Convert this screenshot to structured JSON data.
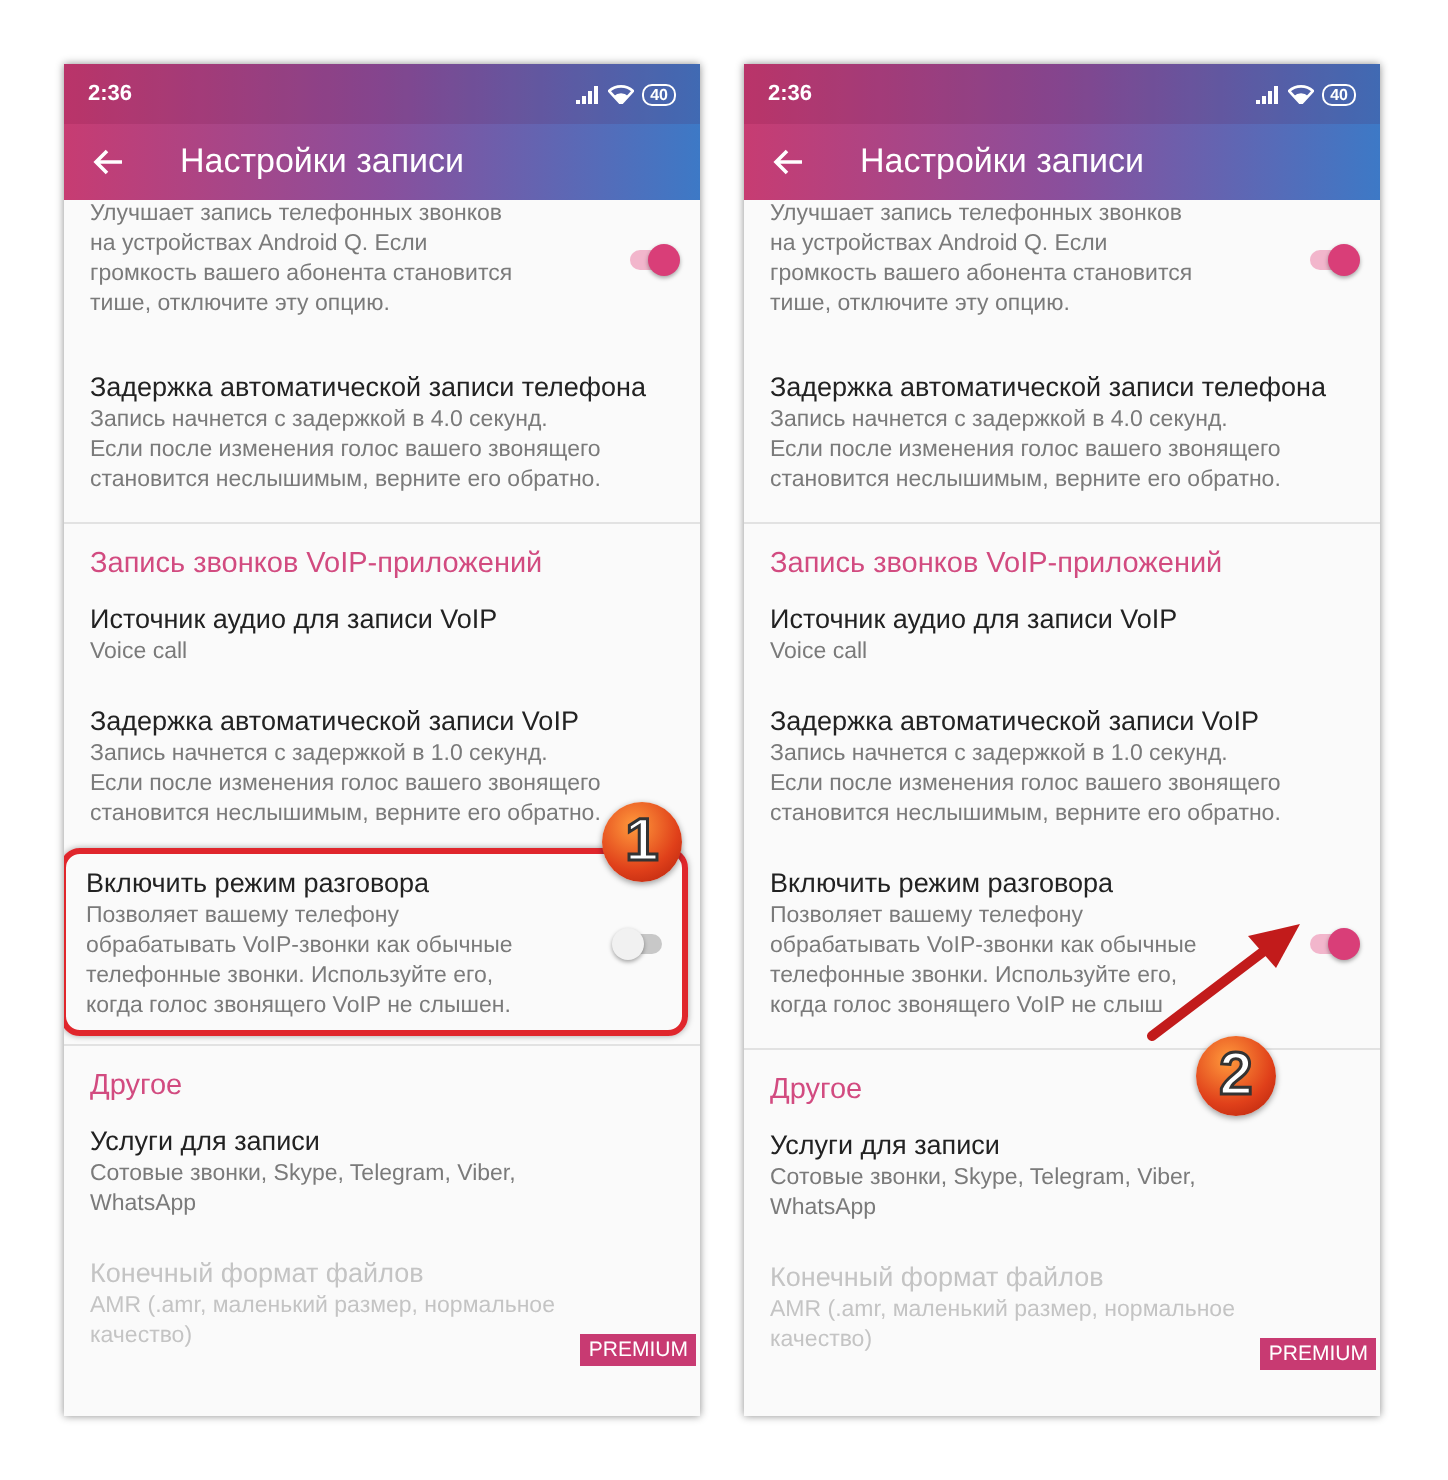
{
  "screens": [
    {
      "status_bar": {
        "time": "2:36",
        "battery": "40"
      },
      "app_bar": {
        "title": "Настройки записи"
      },
      "items": [
        {
          "kind": "switch",
          "summary": "Улучшает запись телефонных звонков на устройствах Android Q. Если громкость вашего абонента становится тише, отключите эту опцию.",
          "on": true
        },
        {
          "kind": "text",
          "title": "Задержка автоматической записи телефона",
          "summary": "Запись начнется с задержкой в 4.0 секунд. Если после изменения голос вашего звонящего становится неслышимым, верните его обратно."
        },
        {
          "kind": "header",
          "title": "Запись звонков VoIP-приложений"
        },
        {
          "kind": "text",
          "title": "Источник аудио для записи VoIP",
          "summary": "Voice call"
        },
        {
          "kind": "text",
          "title": "Задержка автоматической записи VoIP",
          "summary": "Запись начнется с задержкой в 1.0 секунд. Если после изменения голос вашего звонящего становится неслышимым, верните его обратно."
        },
        {
          "kind": "switch",
          "title": "Включить режим разговора",
          "summary": "Позволяет вашему телефону обрабатывать VoIP-звонки как обычные телефонные звонки. Используйте его, когда голос звонящего VoIP не слышен.",
          "on": false,
          "annotation": {
            "number": "1",
            "kind": "frame"
          }
        },
        {
          "kind": "header",
          "title": "Другое"
        },
        {
          "kind": "text",
          "title": "Услуги для записи",
          "summary": "Сотовые звонки, Skype, Telegram, Viber, WhatsApp"
        },
        {
          "kind": "premium",
          "title": "Конечный формат файлов",
          "summary": "AMR (.amr, маленький размер, нормальное качество)",
          "badge": "PREMIUM"
        }
      ]
    },
    {
      "status_bar": {
        "time": "2:36",
        "battery": "40"
      },
      "app_bar": {
        "title": "Настройки записи"
      },
      "items": [
        {
          "kind": "switch",
          "summary": "Улучшает запись телефонных звонков на устройствах Android Q. Если громкость вашего абонента становится тише, отключите эту опцию.",
          "on": true
        },
        {
          "kind": "text",
          "title": "Задержка автоматической записи телефона",
          "summary": "Запись начнется с задержкой в 4.0 секунд. Если после изменения голос вашего звонящего становится неслышимым, верните его обратно."
        },
        {
          "kind": "header",
          "title": "Запись звонков VoIP-приложений"
        },
        {
          "kind": "text",
          "title": "Источник аудио для записи VoIP",
          "summary": "Voice call"
        },
        {
          "kind": "text",
          "title": "Задержка автоматической записи VoIP",
          "summary": "Запись начнется с задержкой в 1.0 секунд. Если после изменения голос вашего звонящего становится неслышимым, верните его обратно."
        },
        {
          "kind": "switch",
          "title": "Включить режим разговора",
          "summary": "Позволяет вашему телефону обрабатывать VoIP-звонки как обычные телефонные звонки. Используйте его, когда голос звонящего VoIP не слыш",
          "on": true,
          "annotation": {
            "number": "2",
            "kind": "arrow"
          }
        },
        {
          "kind": "header",
          "title": "Другое"
        },
        {
          "kind": "text",
          "title": "Услуги для записи",
          "summary": "Сотовые звонки, Skype, Telegram, Viber, WhatsApp"
        },
        {
          "kind": "premium",
          "title": "Конечный формат файлов",
          "summary": "AMR (.amr, маленький размер, нормальное качество)",
          "badge": "PREMIUM"
        }
      ]
    }
  ]
}
